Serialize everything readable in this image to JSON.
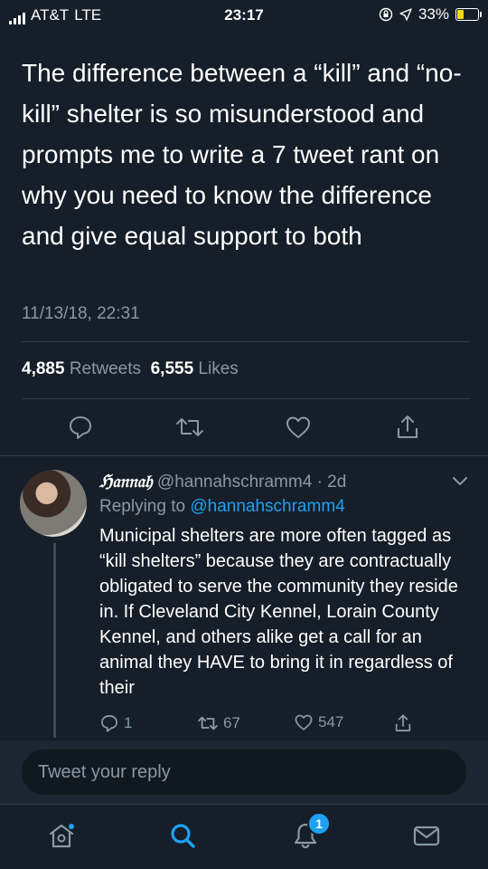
{
  "status_bar": {
    "carrier": "AT&T",
    "network": "LTE",
    "time": "23:17",
    "battery": "33%",
    "battery_level": 0.33,
    "battery_color": "#f5d90a"
  },
  "tweet": {
    "text": "The difference between a “kill” and “no-kill” shelter is so misunderstood and prompts me to write a 7 tweet rant on why you need to know the difference and give equal support to both",
    "date": "11/13/18, 22:31",
    "retweets": "4,885",
    "retweets_label": "Retweets",
    "likes": "6,555",
    "likes_label": "Likes"
  },
  "reply": {
    "name": "ℌ𝔞𝔫𝔫𝔞𝔥",
    "handle": "@hannahschramm4",
    "age": "· 2d",
    "replying_prefix": "Replying to",
    "replying_to": "@hannahschramm4",
    "text": "Municipal shelters are more often tagged as “kill shelters” because they are contractually obligated to serve the community they reside in. If Cleveland City Kennel, Lorain County Kennel, and others alike get a call for an animal they HAVE to bring it in regardless of their",
    "reply_count": "1",
    "retweet_count": "67",
    "like_count": "547"
  },
  "composer": {
    "placeholder": "Tweet your reply"
  },
  "tabbar": {
    "notifications_badge": "1",
    "accent_color": "#1da1f2"
  },
  "colors": {
    "background": "#151e29",
    "muted": "#8899a6",
    "accent": "#1da1f2"
  }
}
